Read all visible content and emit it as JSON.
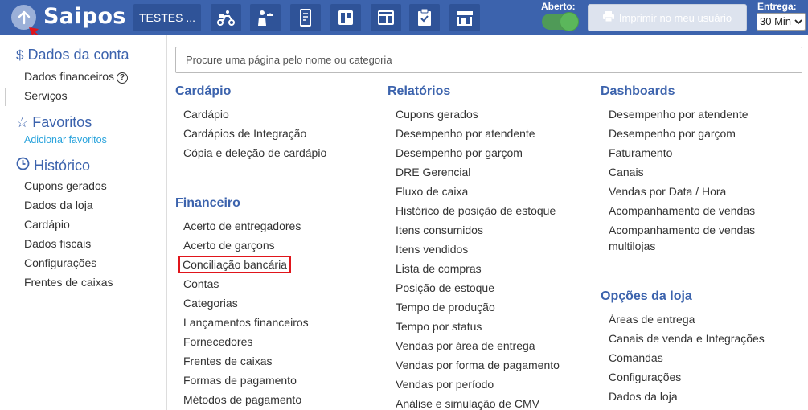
{
  "topbar": {
    "logo": "Saipos",
    "store_button": "TESTES ...",
    "tools": [
      "delivery-scooter-icon",
      "waiter-icon",
      "receipt-phone-icon",
      "kanban-icon",
      "layout-icon",
      "clipboard-check-icon",
      "store-icon"
    ],
    "open_label": "Aberto:",
    "print_button": "Imprimir no meu usuário",
    "delivery_label": "Entrega:",
    "delivery_value": "30 Min"
  },
  "sidebar": {
    "account": {
      "title": "Dados da conta",
      "items": [
        "Dados financeiros",
        "Serviços"
      ]
    },
    "favorites": {
      "title": "Favoritos",
      "add_link": "Adicionar favoritos"
    },
    "history": {
      "title": "Histórico",
      "items": [
        "Cupons gerados",
        "Dados da loja",
        "Cardápio",
        "Dados fiscais",
        "Configurações",
        "Frentes de caixas"
      ]
    }
  },
  "search": {
    "placeholder": "Procure uma página pelo nome ou categoria"
  },
  "columns": {
    "cardapio": {
      "title": "Cardápio",
      "items": [
        "Cardápio",
        "Cardápios de Integração",
        "Cópia e deleção de cardápio"
      ]
    },
    "financeiro": {
      "title": "Financeiro",
      "items": [
        "Acerto de entregadores",
        "Acerto de garçons",
        "Conciliação bancária",
        "Contas",
        "Categorias",
        "Lançamentos financeiros",
        "Fornecedores",
        "Frentes de caixas",
        "Formas de pagamento",
        "Métodos de pagamento"
      ]
    },
    "relatorios": {
      "title": "Relatórios",
      "items": [
        "Cupons gerados",
        "Desempenho por atendente",
        "Desempenho por garçom",
        "DRE Gerencial",
        "Fluxo de caixa",
        "Histórico de posição de estoque",
        "Itens consumidos",
        "Itens vendidos",
        "Lista de compras",
        "Posição de estoque",
        "Tempo de produção",
        "Tempo por status",
        "Vendas por área de entrega",
        "Vendas por forma de pagamento",
        "Vendas por período",
        "Análise e simulação de CMV"
      ]
    },
    "dashboards": {
      "title": "Dashboards",
      "items": [
        "Desempenho por atendente",
        "Desempenho por garçom",
        "Faturamento",
        "Canais",
        "Vendas por Data / Hora",
        "Acompanhamento de vendas",
        "Acompanhamento de vendas multilojas"
      ]
    },
    "opcoes": {
      "title": "Opções da loja",
      "items": [
        "Áreas de entrega",
        "Canais de venda e Integrações",
        "Comandas",
        "Configurações",
        "Dados da loja"
      ]
    }
  },
  "colors": {
    "header": "#3c63ad",
    "accent": "#3c63ad",
    "link": "#29a3dc",
    "highlight": "#e0151b",
    "toggle_on": "#5bb75b"
  }
}
